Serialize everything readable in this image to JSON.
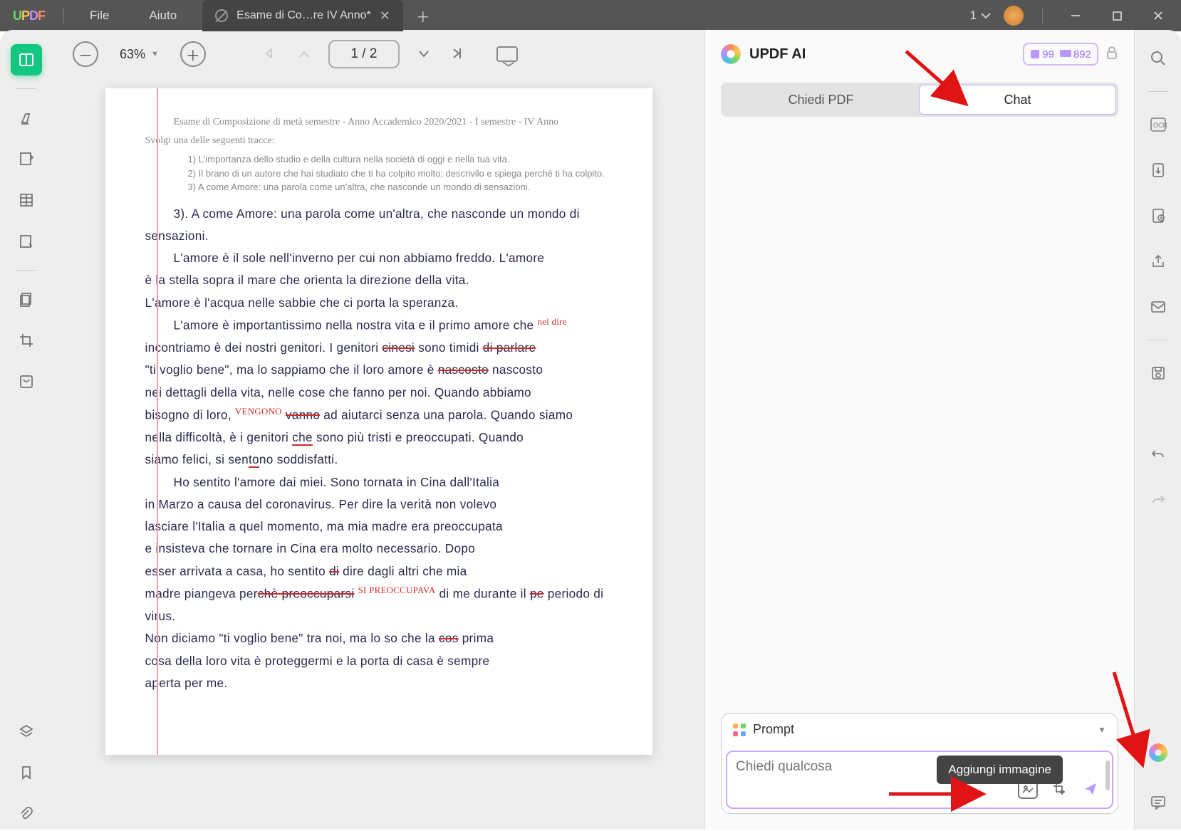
{
  "titlebar": {
    "menus": [
      "File",
      "Aiuto"
    ],
    "tab_title": "Esame di Co…re IV Anno*",
    "page_selector": "1"
  },
  "toolbar": {
    "zoom": "63%",
    "page": "1 / 2"
  },
  "document": {
    "heading": "Esame di Composizione di metà semestre  -  Anno Accademico 2020/2021 - I semestre - IV Anno",
    "instruction": "Svolgi una delle seguenti tracce:",
    "prompts": [
      "1)  L'importanza dello studio e della cultura nella società di oggi e nella tua vita.",
      "2)  Il brano di un autore che hai studiato che ti ha colpito molto; descrivilo e spiega perché ti ha colpito.",
      "3)  A come Amore: una parola come un'altra, che nasconde un mondo di sensazioni."
    ],
    "essay": [
      "3). A come Amore: una parola come un'altra, che nasconde un mondo di sensazioni.",
      "L'amore è il sole nell'inverno per cui non abbiamo freddo. L'amore è la stella sopra il mare che orienta la direzione della vita. L'amore è l'acqua nelle sabbie che ci porta la speranza.",
      "L'amore è importantissimo nella nostra vita e il primo amore che incontriamo è dei nostri genitori. I genitori cinesi sono timidi di parlare \"ti voglio bene\", ma lo sappiamo che il loro amore è nascosto nei dettagli della vita, nelle cose che fanno per noi. Quando abbiamo bisogno di loro, vanno ad aiutarci senza una parola. Quando siamo nella difficoltà, è i genitori che sono più tristi e preoccupati. Quando siamo felici, si sentono soddisfatti.",
      "Ho sentito l'amore dai miei. Sono tornata in Cina dall'Italia in Marzo a causa del coronavirus. Per dire la verità non volevo lasciare l'Italia a quel momento, ma mia madre era preoccupata e insisteva che tornare in Cina era molto necessario. Dopo esser arrivata a casa, ho sentito dire dagli altri che mia madre piangeva per preoccuparsi di me durante il periodo di virus. Non diciamo \"ti voglio bene\" tra noi, ma lo so che la prima cosa della loro vita è proteggermi e la porta di casa è sempre aperta per me.",
      ""
    ],
    "corrections": {
      "nel_dire": "nel dire",
      "vengono": "VENGONO",
      "si_preoccupava": "SI PREOCCUPAVA"
    }
  },
  "ai": {
    "title": "UPDF AI",
    "credits": {
      "a": "99",
      "b": "892"
    },
    "modes": {
      "ask": "Chiedi PDF",
      "chat": "Chat"
    },
    "prompt_label": "Prompt",
    "placeholder": "Chiedi qualcosa",
    "tooltip_add_image": "Aggiungi immagine"
  }
}
